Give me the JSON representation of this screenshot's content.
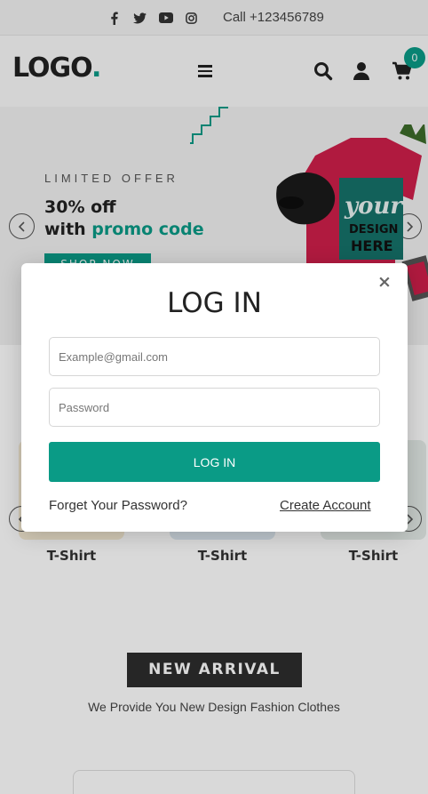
{
  "topbar": {
    "social_icons": [
      "facebook-icon",
      "twitter-icon",
      "youtube-icon",
      "instagram-icon"
    ],
    "call_text": "Call +123456789"
  },
  "header": {
    "logo_text": "LOGO",
    "logo_dot": ".",
    "cart_count": "0",
    "icons": [
      "menu-icon",
      "search-icon",
      "user-icon",
      "cart-icon"
    ]
  },
  "hero": {
    "eyebrow": "LIMITED OFFER",
    "title_line1": "30% off",
    "title_prefix": "with ",
    "title_accent": "promo code",
    "shop_button": "SHOP NOW",
    "art_text_1": "your",
    "art_text_2": "DESIGN",
    "art_text_3": "HERE"
  },
  "categories": {
    "items": [
      {
        "label": "T-Shirt",
        "color": "#f6ebd4"
      },
      {
        "label": "T-Shirt",
        "color": "#dde8f0"
      },
      {
        "label": "T-Shirt",
        "color": "#e4ece8"
      }
    ]
  },
  "new_arrival": {
    "heading": "NEW ARRIVAL",
    "subtitle": "We Provide You New Design Fashion Clothes"
  },
  "login_modal": {
    "close": "×",
    "title": "LOG IN",
    "email_placeholder": "Example@gmail.com",
    "password_placeholder": "Password",
    "submit": "LOG IN",
    "forgot": "Forget Your Password?",
    "create": "Create Account"
  },
  "colors": {
    "accent": "#0a9b86",
    "dark": "#2d2d2d"
  }
}
